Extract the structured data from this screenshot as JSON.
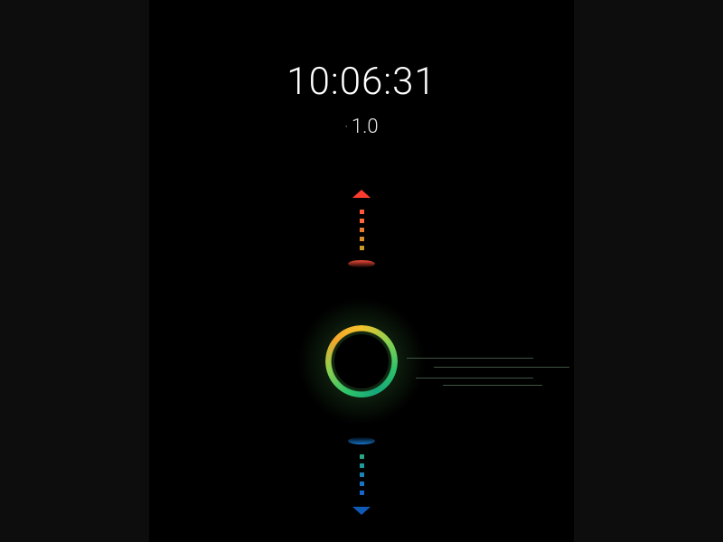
{
  "display": {
    "time": "10:06:31",
    "subvalue_prefix": "·",
    "subvalue": "1.0"
  },
  "colors": {
    "up_arrow": "#ff3b2e",
    "down_arrow": "#0e5ab5",
    "ring_green": "#2ec46a",
    "ring_yellow": "#f4c22b",
    "trail": "#3e5440"
  },
  "compass": {
    "upper_dots": [
      "#ff5a3a",
      "#ff6a3a",
      "#e97a34",
      "#d98c2e",
      "#c99a2a"
    ],
    "lower_dots": [
      "#2aa686",
      "#1f9aa0",
      "#1a84b4",
      "#1674c0",
      "#1466c8"
    ]
  }
}
